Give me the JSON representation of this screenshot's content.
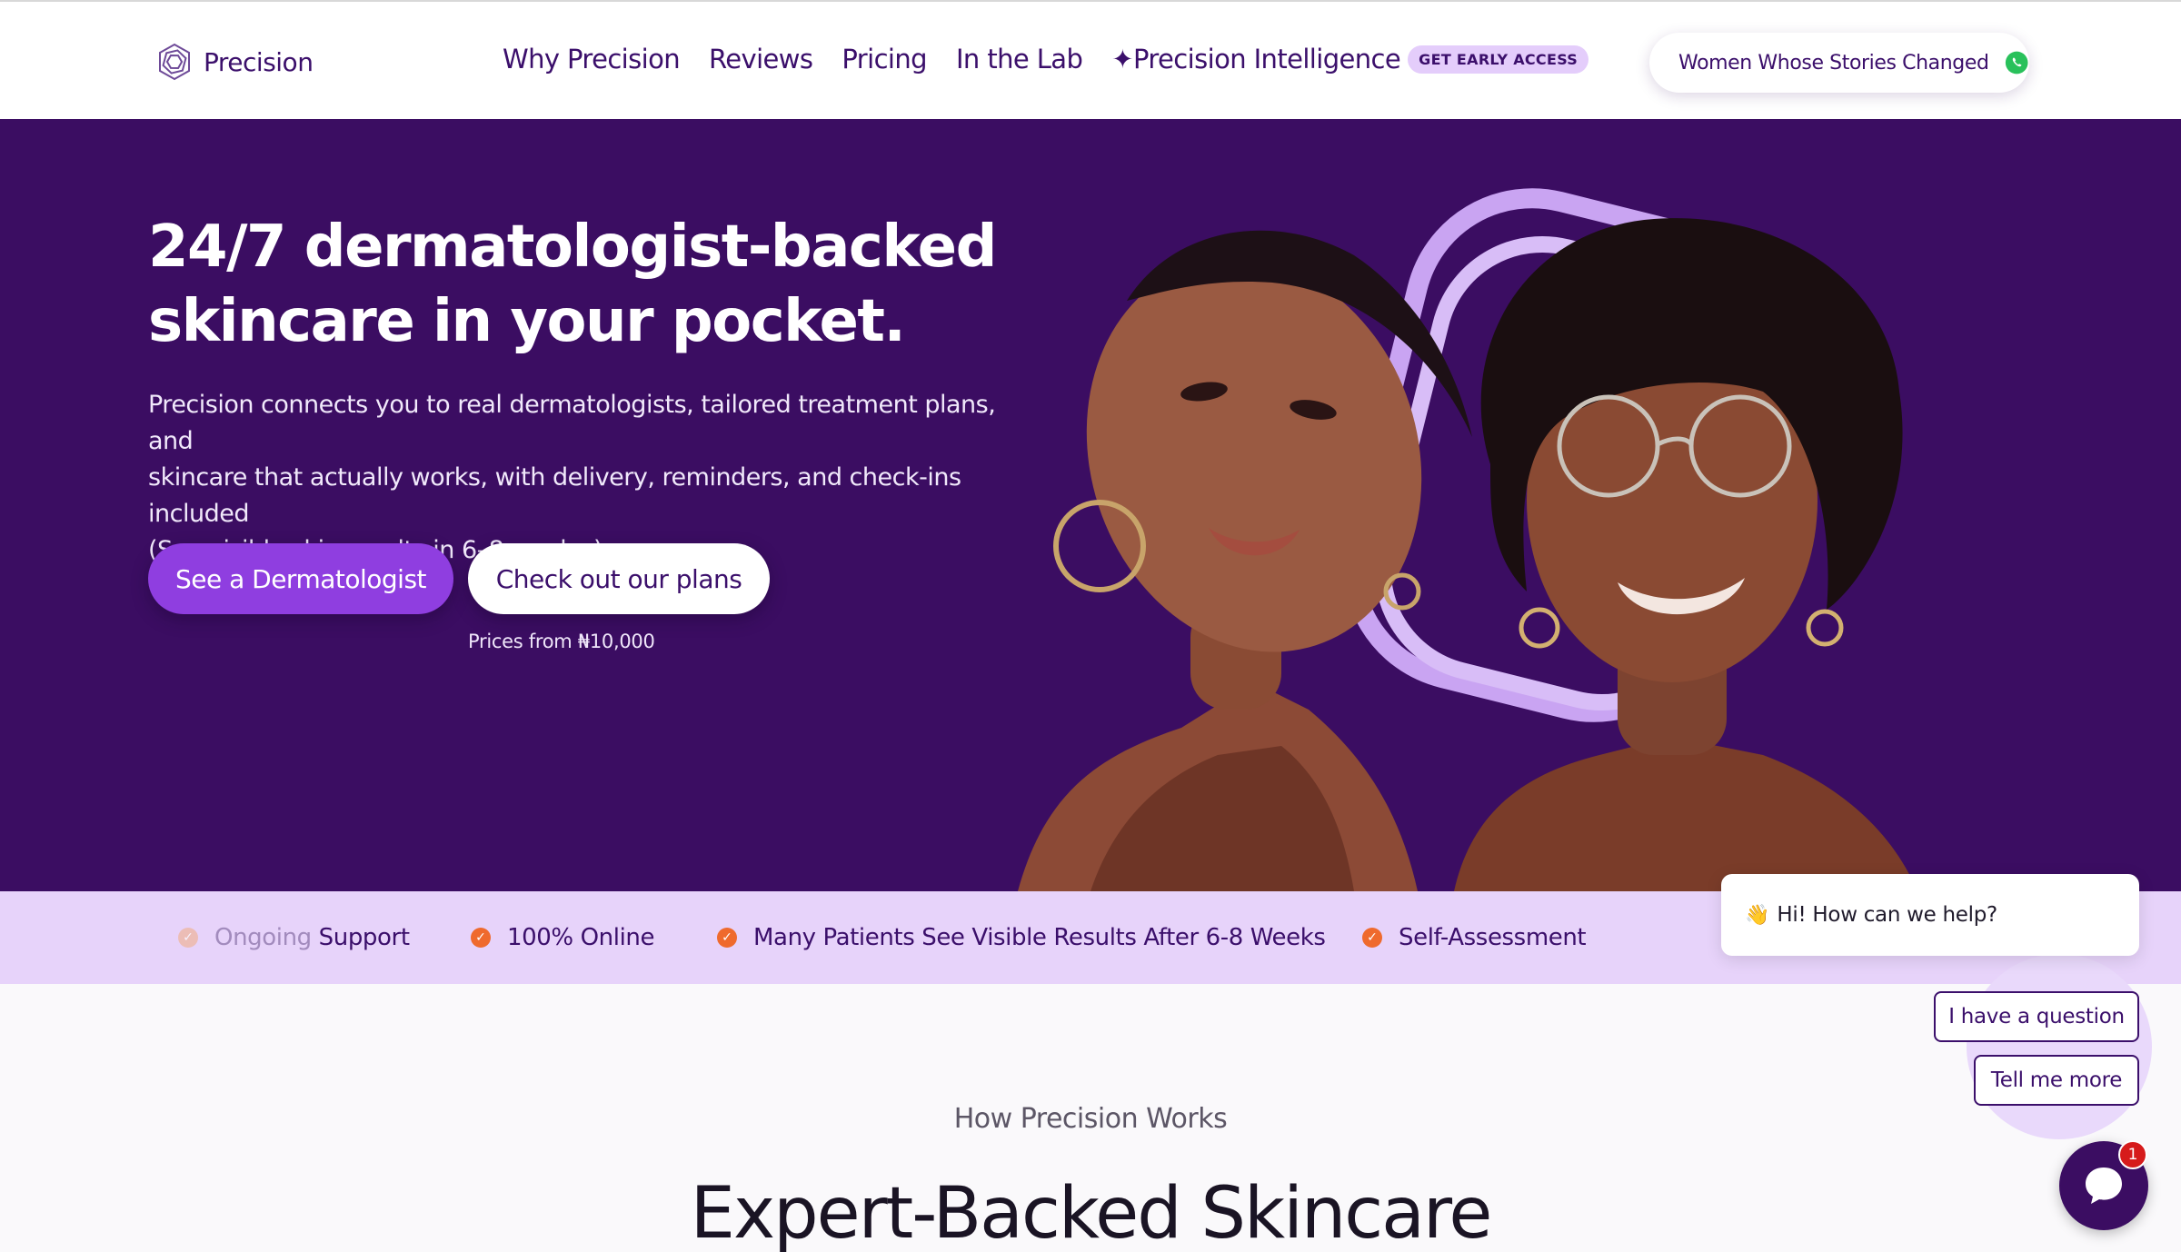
{
  "nav": {
    "brand": "Precision",
    "links": [
      "Why Precision",
      "Reviews",
      "Pricing",
      "In the Lab"
    ],
    "ai_link": "✦Precision Intelligence",
    "early_access": "GET EARLY ACCESS",
    "stories_button": "Women Whose Stories Changed"
  },
  "hero": {
    "title_line1": "24/7 dermatologist-backed",
    "title_line2": "skincare in your pocket.",
    "sub_line1": "Precision connects you to real dermatologists, tailored treatment plans, and",
    "sub_line2": "skincare that actually works, with delivery, reminders, and check-ins included",
    "sub_line3": "(See visible skin results in 6–8 weeks.)",
    "primary_cta": "See a Dermatologist",
    "secondary_cta": "Check out our plans",
    "price_note": "Prices from ₦10,000"
  },
  "features": {
    "ongoing_faded": "Ongoing",
    "ongoing_rest": " Support",
    "online": "100% Online",
    "results": "Many Patients See Visible Results After 6-8 Weeks",
    "assessment": "Self-Assessment"
  },
  "section": {
    "kicker": "How Precision Works",
    "title": "Expert-Backed Skincare"
  },
  "chat": {
    "wave": "👋",
    "greeting": "Hi! How can we help?",
    "reply1": "I have a question",
    "reply2": "Tell me more",
    "unread": "1"
  },
  "colors": {
    "brand_purple": "#3b0d62",
    "accent_purple": "#8f3ee0",
    "feature_strip": "#e7d3fa",
    "check_orange": "#ef6a2d"
  }
}
